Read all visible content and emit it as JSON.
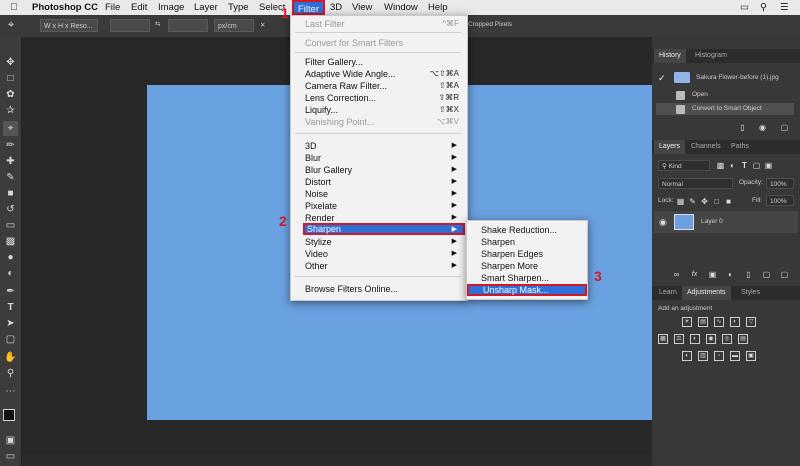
{
  "menubar": {
    "apple": "",
    "items": [
      "Photoshop CC",
      "File",
      "Edit",
      "Image",
      "Layer",
      "Type",
      "Select",
      "Filter",
      "3D",
      "View",
      "Window",
      "Help"
    ]
  },
  "options": {
    "style_dropdown": "W x H x Reso...",
    "unit_dropdown": "px/cm",
    "right_text": "Cropped Pixels"
  },
  "filter_menu": {
    "last_filter": {
      "label": "Last Filter",
      "shortcut": "^⌘F"
    },
    "convert": "Convert for Smart Filters",
    "group2": [
      {
        "label": "Filter Gallery...",
        "shortcut": ""
      },
      {
        "label": "Adaptive Wide Angle...",
        "shortcut": "⌥⇧⌘A"
      },
      {
        "label": "Camera Raw Filter...",
        "shortcut": "⇧⌘A"
      },
      {
        "label": "Lens Correction...",
        "shortcut": "⇧⌘R"
      },
      {
        "label": "Liquify...",
        "shortcut": "⇧⌘X"
      },
      {
        "label": "Vanishing Point...",
        "shortcut": "⌥⌘V"
      }
    ],
    "submenus": [
      "3D",
      "Blur",
      "Blur Gallery",
      "Distort",
      "Noise",
      "Pixelate",
      "Render",
      "Sharpen",
      "Stylize",
      "Video",
      "Other"
    ],
    "browse": "Browse Filters Online..."
  },
  "sharpen_menu": {
    "items": [
      "Shake Reduction...",
      "Sharpen",
      "Sharpen Edges",
      "Sharpen More",
      "Smart Sharpen...",
      "Unsharp Mask..."
    ]
  },
  "steps": {
    "one": "1",
    "two": "2",
    "three": "3"
  },
  "history": {
    "tabs": [
      "History",
      "Histogram"
    ],
    "snapshot": "Sakura Flower-before (1).jpg",
    "rows": [
      "Open",
      "Convert to Smart Object"
    ]
  },
  "layers": {
    "tabs": [
      "Layers",
      "Channels",
      "Paths"
    ],
    "kind": "Kind",
    "blend": "Normal",
    "opacity_label": "Opacity:",
    "opacity_value": "100%",
    "lock_label": "Lock:",
    "fill_label": "Fill:",
    "fill_value": "100%",
    "layer_name": "Layer 0"
  },
  "adjustments": {
    "tabs": [
      "Learn",
      "Adjustments",
      "Styles"
    ],
    "add_label": "Add an adjustment"
  },
  "colors": {
    "accent": "#2f6fd8",
    "annotation": "#d0182a",
    "canvas": "#6aa1e0"
  }
}
